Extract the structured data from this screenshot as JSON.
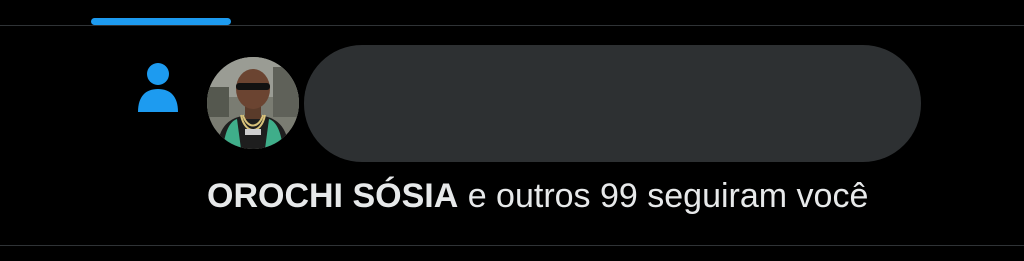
{
  "colors": {
    "background": "#000000",
    "accent": "#1d9bf0",
    "divider": "#2f3336",
    "text": "#e7e9ea",
    "redacted": "#2d3032"
  },
  "notification": {
    "icon": "person-icon",
    "user_name": "OROCHI SÓSIA",
    "message": "e outros 99 seguiram você"
  }
}
